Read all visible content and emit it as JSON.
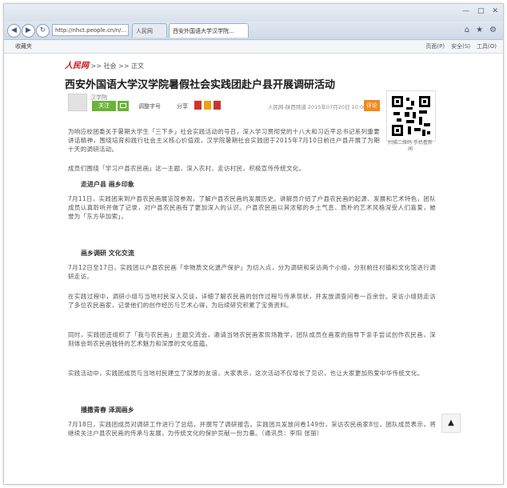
{
  "browser": {
    "address": "http://nhct.people.cn/n/...",
    "tabs": [
      {
        "label": "人民网",
        "active": false
      },
      {
        "label": "西安外国语大学汉学院...",
        "active": true
      }
    ],
    "favorites_label": "收藏夹",
    "toolbar_items": [
      "页面(P)",
      "安全(S)",
      "工具(O)"
    ]
  },
  "site": {
    "logo": "人民网",
    "breadcrumb": ">> 社会 >> 正文"
  },
  "article": {
    "headline": "西安外国语大学汉学院暑假社会实践团赴户县开展调研活动",
    "author": "汉学院",
    "follow_label": "关注",
    "font_size_label": "调整字号",
    "share_label": "分享",
    "meta": "人民网-陕西频道 2015年07月20日 10:00",
    "orange_btn": "评论",
    "qr_caption": "扫描二维码 手机看新闻",
    "paragraphs": [
      "为响应校团委关于暑期大学生「三下乡」社会实践活动的号召，深入学习贯彻党的十八大和习近平总书记系列重要讲话精神，围绕培育和践行社会主义核心价值观，汉学院暑期社会实践团于2015年7月10日前往户县开展了为期十天的调研活动。",
      "成员们围绕「学习户县农民画」这一主题，深入农村、走访村民，积极宣传传统文化。"
    ],
    "section1_title": "走进户县 画乡印象",
    "section1_text": "7月11日，实践团来到户县农民画展览馆参观，了解户县农民画的发展历史。讲解员介绍了户县农民画的起源、发展和艺术特色，团队成员认真聆听并做了记录，对户县农民画有了更加深入的认识。户县农民画以其浓郁的乡土气息、质朴的艺术风格深受人们喜爱，被誉为「东方毕加索」。",
    "section2_title": "画乡调研 文化交流",
    "section2_text": "7月12日至17日，实践团以户县农民画「非物质文化遗产保护」为切入点，分为调研和采访两个小组，分别前往村镇和文化馆进行调研走访。",
    "paragraphs2": [
      "在实践过程中，调研小组与当地村民深入交谈，详细了解农民画的创作过程与传承现状，并发放调查问卷一百余份。采访小组则走访了多位农民画家，记录他们的创作经历与艺术心得，为后续研究积累了宝贵资料。",
      "同时，实践团还组织了「我与农民画」主题交流会，邀请当地农民画家现场教学，团队成员在画家的指导下亲手尝试创作农民画，深刻体会到农民画独特的艺术魅力和深厚的文化底蕴。",
      "实践活动中，实践团成员与当地村民建立了深厚的友谊，大家表示，这次活动不仅增长了见识，也让大家更加热爱中华传统文化。"
    ],
    "section3_title": "播撒青春 泽润画乡",
    "section3_text": "7月18日，实践团成员对调研工作进行了总结，并撰写了调研报告。实践团共发放问卷149份，采访农民画家8位，团队成员表示，将继续关注户县农民画的传承与发展，为传统文化的保护贡献一份力量。（通讯员：李阳 张丽）"
  },
  "icons": {
    "scroll_top": "up-arrow-icon"
  }
}
